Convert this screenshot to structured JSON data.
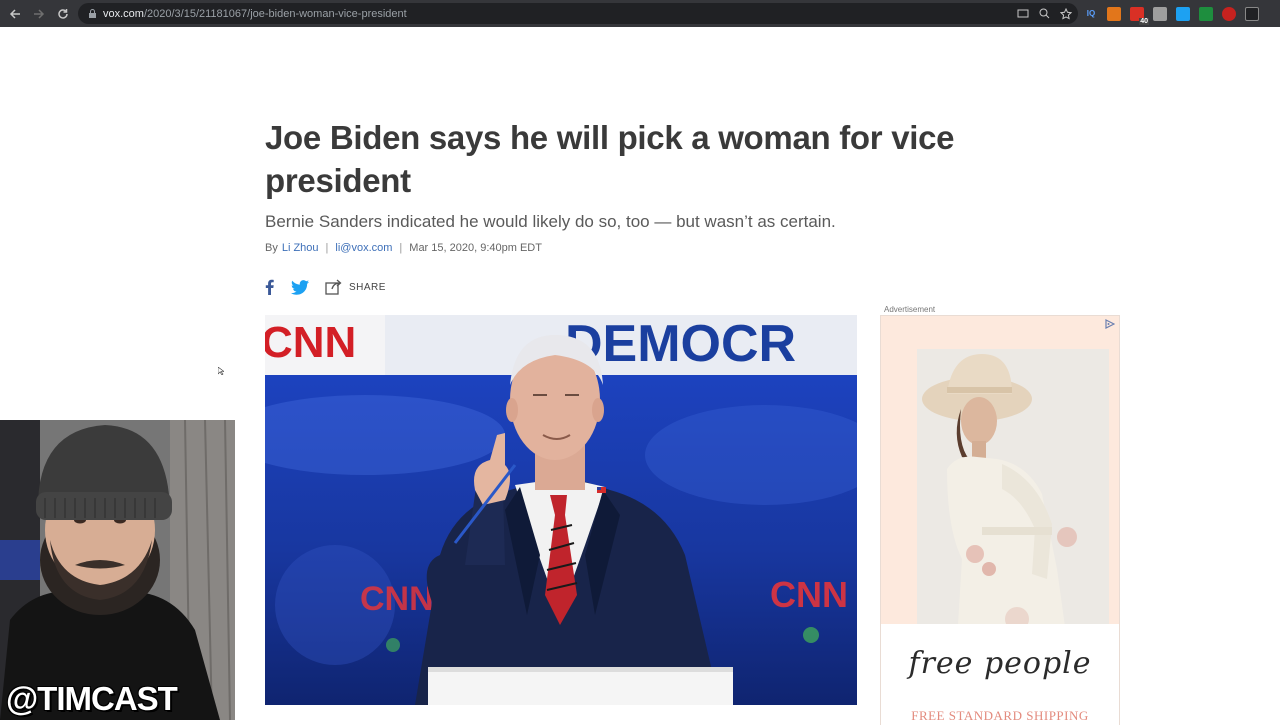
{
  "browser": {
    "url_host": "vox.com",
    "url_path": "/2020/3/15/21181067/joe-biden-woman-vice-president",
    "extension_badge": "40",
    "extension_iq": "IQ"
  },
  "article": {
    "headline": "Joe Biden says he will pick a woman for vice president",
    "dek": "Bernie Sanders indicated he would likely do so, too — but wasn’t as certain.",
    "byline_prefix": "By",
    "author": "Li Zhou",
    "email": "li@vox.com",
    "timestamp": "Mar 15, 2020, 9:40pm EDT",
    "share_label": "SHARE"
  },
  "hero": {
    "banner_text": "DEMOCR",
    "logo_left": "CNN",
    "logo_right": "CNN"
  },
  "ad": {
    "label": "Advertisement",
    "brand": "free people",
    "shipping": "FREE STANDARD SHIPPING"
  },
  "overlay": {
    "watermark": "@TIMCAST"
  },
  "colors": {
    "facebook": "#3b5998",
    "twitter": "#1da1f2",
    "headline": "#3a3a3a",
    "link": "#3d6fb8",
    "ad_bg": "#fde9dd"
  }
}
